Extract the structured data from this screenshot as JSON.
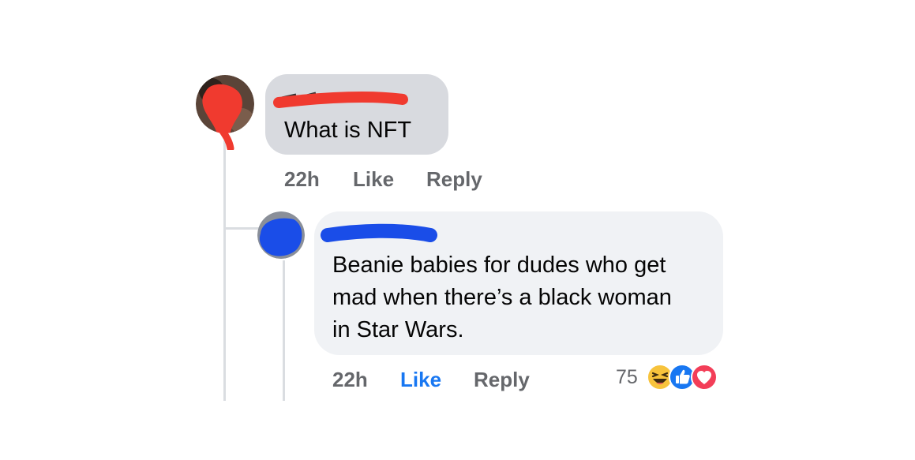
{
  "comment_1": {
    "text": "What is NFT",
    "time": "22h",
    "like_label": "Like",
    "reply_label": "Reply"
  },
  "comment_2": {
    "text_lines": [
      "Beanie babies for dudes who get",
      "mad when there’s a black woman",
      "in Star Wars."
    ],
    "time": "22h",
    "like_label": "Like",
    "reply_label": "Reply",
    "reaction_count": "75",
    "reactions": [
      "haha-icon",
      "like-icon",
      "love-icon"
    ]
  },
  "colors": {
    "redaction_red": "#f03a2f",
    "redaction_blue": "#1a4de8",
    "like_blue": "#1877f2",
    "meta_gray": "#65676b",
    "thread_line": "#dadde1"
  }
}
